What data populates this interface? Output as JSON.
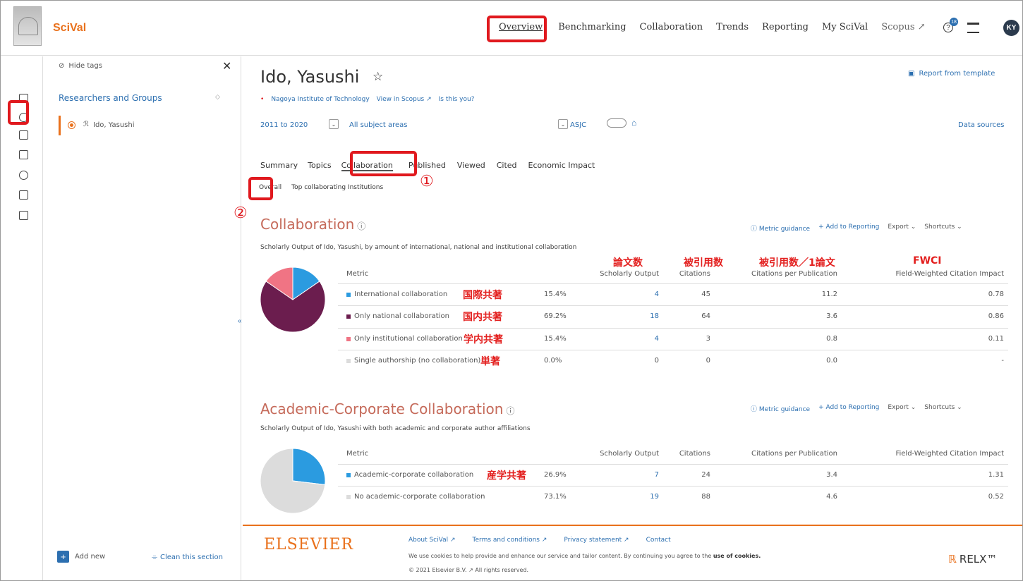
{
  "app": {
    "name": "SciVal",
    "avatar_initials": "KY",
    "notif_count": "18"
  },
  "nav": {
    "items": [
      "Overview",
      "Benchmarking",
      "Collaboration",
      "Trends",
      "Reporting",
      "My SciVal",
      "Scopus ↗"
    ]
  },
  "panel": {
    "hide_tags": "Hide tags",
    "section": "Researchers and Groups",
    "item": "Ido, Yasushi",
    "add_new": "Add new",
    "clean": "Clean this section"
  },
  "entity": {
    "name": "Ido, Yasushi",
    "affiliation": "Nagoya Institute of Technology",
    "view_scopus": "View in Scopus ↗",
    "is_you": "Is this you?",
    "report_template": "Report from template",
    "years": "2011 to 2020",
    "subject": "All subject areas",
    "asjc": "ASJC",
    "data_sources": "Data sources"
  },
  "tabs": {
    "items": [
      "Summary",
      "Topics",
      "Collaboration",
      "Published",
      "Viewed",
      "Cited",
      "Economic Impact"
    ],
    "sub": [
      "Overall",
      "Top collaborating Institutions"
    ],
    "marker1": "①",
    "marker2": "②"
  },
  "collab": {
    "title": "Collaboration",
    "desc": "Scholarly Output of Ido, Yasushi, by amount of international, national and institutional collaboration",
    "metric_guidance": "Metric guidance",
    "add_reporting": "+ Add to Reporting",
    "export": "Export",
    "shortcuts": "Shortcuts",
    "jp_headers": [
      "論文数",
      "被引用数",
      "被引用数／1論文",
      "FWCI"
    ],
    "headers": [
      "Metric",
      "Scholarly Output",
      "Citations",
      "Citations per Publication",
      "Field-Weighted Citation Impact"
    ],
    "rows": [
      {
        "label": "International collaboration",
        "jp": "国際共著",
        "pct": "15.4%",
        "output": "4",
        "cit": "45",
        "cpp": "11.2",
        "fwci": "0.78",
        "color": "#2b9be0",
        "frac": 0.154
      },
      {
        "label": "Only national collaboration",
        "jp": "国内共著",
        "pct": "69.2%",
        "output": "18",
        "cit": "64",
        "cpp": "3.6",
        "fwci": "0.86",
        "color": "#6b1d4e",
        "frac": 0.692
      },
      {
        "label": "Only institutional collaboration",
        "jp": "学内共著",
        "pct": "15.4%",
        "output": "4",
        "cit": "3",
        "cpp": "0.8",
        "fwci": "0.11",
        "color": "#f07484",
        "frac": 0.154
      },
      {
        "label": "Single authorship (no collaboration)",
        "jp": "単著",
        "pct": "0.0%",
        "output": "0",
        "cit": "0",
        "cpp": "0.0",
        "fwci": "-",
        "color": "#dcdcdc",
        "frac": 0.0
      }
    ]
  },
  "acad": {
    "title": "Academic-Corporate Collaboration",
    "desc": "Scholarly Output of Ido, Yasushi with both academic and corporate author affiliations",
    "headers": [
      "Metric",
      "Scholarly Output",
      "Citations",
      "Citations per Publication",
      "Field-Weighted Citation Impact"
    ],
    "rows": [
      {
        "label": "Academic-corporate collaboration",
        "jp": "産学共著",
        "pct": "26.9%",
        "output": "7",
        "cit": "24",
        "cpp": "3.4",
        "fwci": "1.31",
        "color": "#2b9be0",
        "frac": 0.269
      },
      {
        "label": "No academic-corporate collaboration",
        "jp": "",
        "pct": "73.1%",
        "output": "19",
        "cit": "88",
        "cpp": "4.6",
        "fwci": "0.52",
        "color": "#dcdcdc",
        "frac": 0.731
      }
    ]
  },
  "footer": {
    "brand": "ELSEVIER",
    "links": [
      "About SciVal ↗",
      "Terms and conditions ↗",
      "Privacy statement ↗",
      "Contact"
    ],
    "cookies_pre": "We use cookies to help provide and enhance our service and tailor content. By continuing you agree to the",
    "cookies_bold": "use of cookies.",
    "copyright": "© 2021 Elsevier B.V. ↗ All rights reserved.",
    "relx": "RELX™"
  }
}
